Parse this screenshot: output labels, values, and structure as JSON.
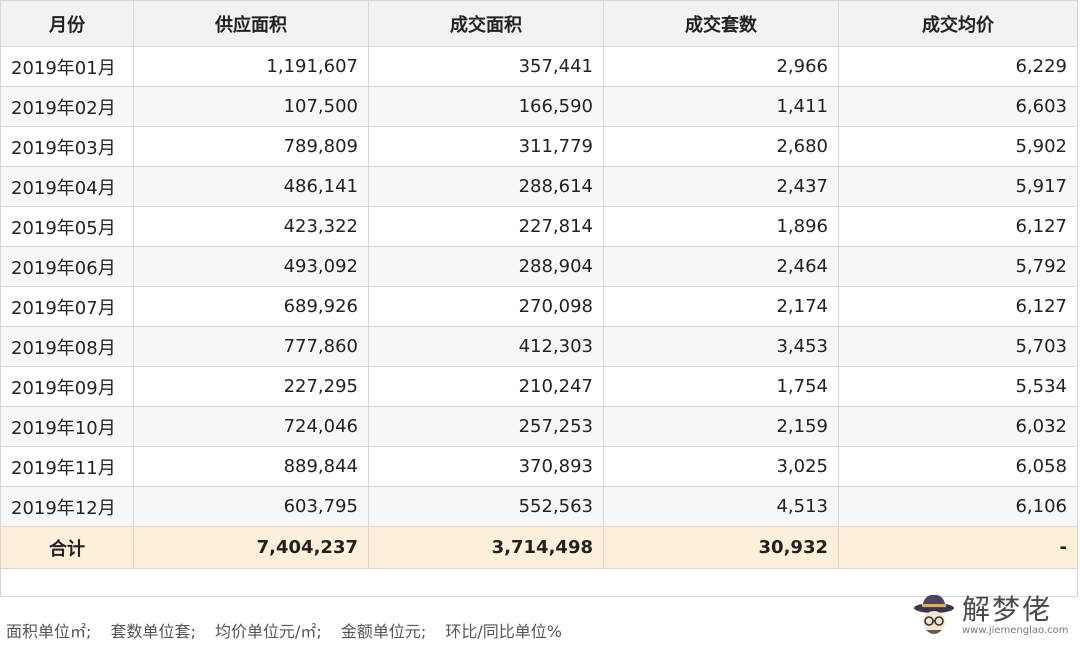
{
  "table": {
    "headers": [
      "月份",
      "供应面积",
      "成交面积",
      "成交套数",
      "成交均价"
    ],
    "rows": [
      [
        "2019年01月",
        "1,191,607",
        "357,441",
        "2,966",
        "6,229"
      ],
      [
        "2019年02月",
        "107,500",
        "166,590",
        "1,411",
        "6,603"
      ],
      [
        "2019年03月",
        "789,809",
        "311,779",
        "2,680",
        "5,902"
      ],
      [
        "2019年04月",
        "486,141",
        "288,614",
        "2,437",
        "5,917"
      ],
      [
        "2019年05月",
        "423,322",
        "227,814",
        "1,896",
        "6,127"
      ],
      [
        "2019年06月",
        "493,092",
        "288,904",
        "2,464",
        "5,792"
      ],
      [
        "2019年07月",
        "689,926",
        "270,098",
        "2,174",
        "6,127"
      ],
      [
        "2019年08月",
        "777,860",
        "412,303",
        "3,453",
        "5,703"
      ],
      [
        "2019年09月",
        "227,295",
        "210,247",
        "1,754",
        "5,534"
      ],
      [
        "2019年10月",
        "724,046",
        "257,253",
        "2,159",
        "6,032"
      ],
      [
        "2019年11月",
        "889,844",
        "370,893",
        "3,025",
        "6,058"
      ],
      [
        "2019年12月",
        "603,795",
        "552,563",
        "4,513",
        "6,106"
      ]
    ],
    "total": [
      "合计",
      "7,404,237",
      "3,714,498",
      "30,932",
      "-"
    ]
  },
  "footnote": [
    "面积单位㎡;",
    "套数单位套;",
    "均价单位元/㎡;",
    "金额单位元;",
    "环比/同比单位%"
  ],
  "watermark": {
    "title": "解梦佬",
    "url": "www.jiemenglao.com"
  }
}
